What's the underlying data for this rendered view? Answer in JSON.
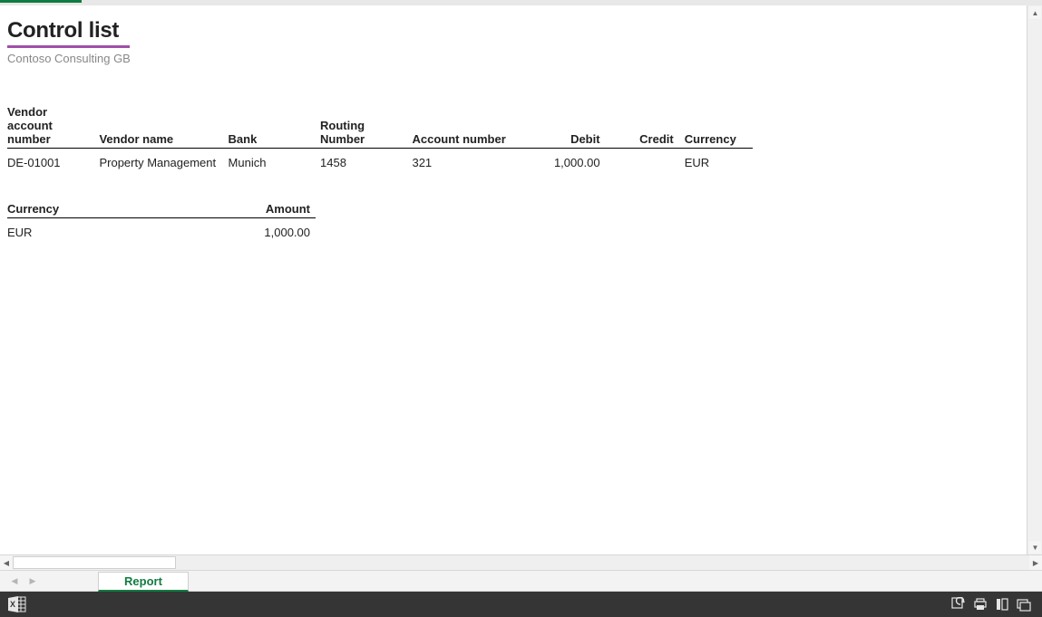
{
  "report": {
    "title": "Control list",
    "subtitle": "Contoso Consulting GB"
  },
  "main_table": {
    "headers": {
      "vendor_account": "Vendor account number",
      "vendor_name": "Vendor name",
      "bank": "Bank",
      "routing": "Routing Number",
      "account": "Account number",
      "debit": "Debit",
      "credit": "Credit",
      "currency": "Currency"
    },
    "rows": [
      {
        "vendor_account": "DE-01001",
        "vendor_name": "Property Management",
        "bank": "Munich",
        "routing": "1458",
        "account": "321",
        "debit": "1,000.00",
        "credit": "",
        "currency": "EUR"
      }
    ]
  },
  "summary_table": {
    "headers": {
      "currency": "Currency",
      "amount": "Amount"
    },
    "rows": [
      {
        "currency": "EUR",
        "amount": "1,000.00"
      }
    ]
  },
  "sheet": {
    "active_tab": "Report"
  }
}
